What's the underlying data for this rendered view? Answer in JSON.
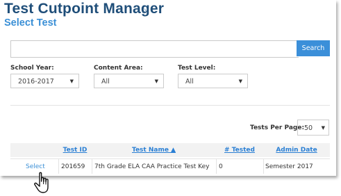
{
  "header": {
    "title": "Test Cutpoint Manager",
    "subtitle": "Select Test",
    "chevron": "›"
  },
  "search": {
    "value": "",
    "placeholder": "",
    "button_label": "Search"
  },
  "filters": {
    "school_year": {
      "label": "School Year:",
      "value": "2016-2017"
    },
    "content_area": {
      "label": "Content Area:",
      "value": "All"
    },
    "test_level": {
      "label": "Test Level:",
      "value": "All"
    }
  },
  "pagination": {
    "label": "Tests Per Page:",
    "value": "50"
  },
  "table": {
    "columns": [
      "",
      "Test ID",
      "Test Name ▲",
      "# Tested",
      "Admin Date"
    ],
    "rows": [
      {
        "action": "Select",
        "test_id": "201659",
        "test_name": "7th Grade ELA CAA Practice Test Key",
        "tested": "0",
        "admin_date": "Semester 2017"
      }
    ]
  },
  "icons": {
    "dropdown": "chevron-down-icon",
    "cursor": "hand-pointer-icon"
  },
  "colors": {
    "title": "#1f4e79",
    "subtitle": "#3a8fd6",
    "accent": "#3b8fd9"
  }
}
